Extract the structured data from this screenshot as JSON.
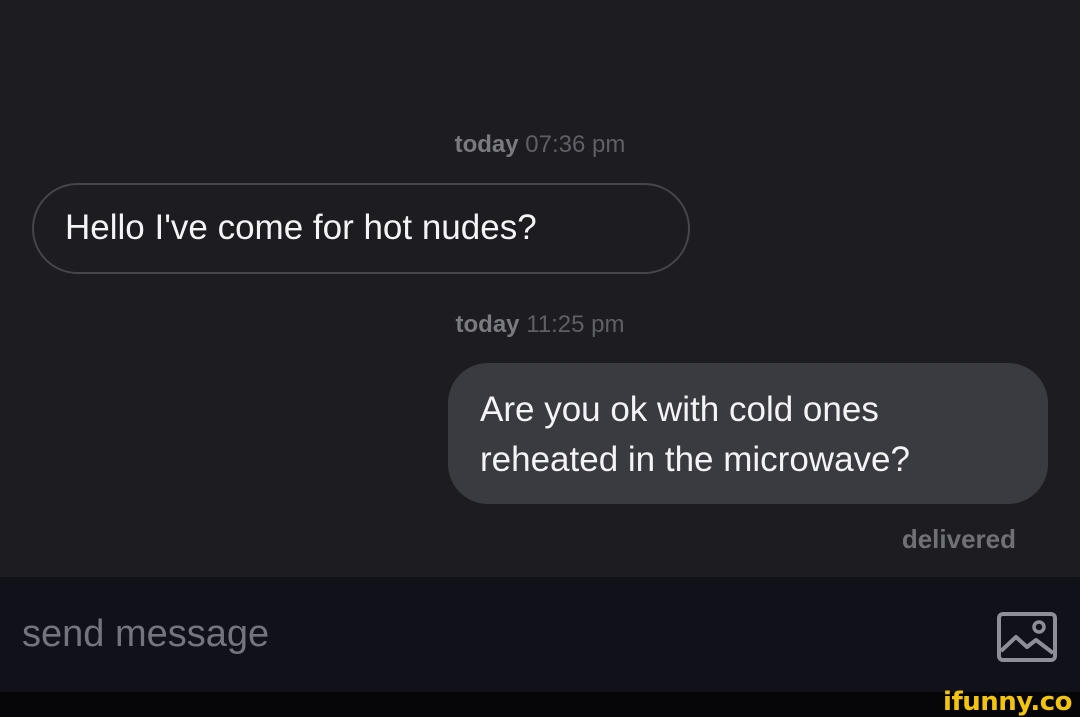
{
  "messages": [
    {
      "timestamp_day": "today",
      "timestamp_time": "07:36 pm",
      "direction": "incoming",
      "text_lines": [
        "Hello I've come for hot nudes?"
      ]
    },
    {
      "timestamp_day": "today",
      "timestamp_time": "11:25 pm",
      "direction": "outgoing",
      "text_lines": [
        "Are you ok with cold ones",
        "reheated in the microwave?"
      ]
    }
  ],
  "status": "delivered",
  "composer": {
    "placeholder": "send message",
    "value": "",
    "attach_icon": "image-icon"
  },
  "watermark": "ifunny.co",
  "colors": {
    "background": "#1c1c21",
    "composer_background": "#111119",
    "outgoing_bubble": "#3a3a41",
    "incoming_bubble_border": "#45454c",
    "message_text": "#f4f4f6",
    "meta_text": "#707077",
    "watermark": "#f2c40f"
  }
}
